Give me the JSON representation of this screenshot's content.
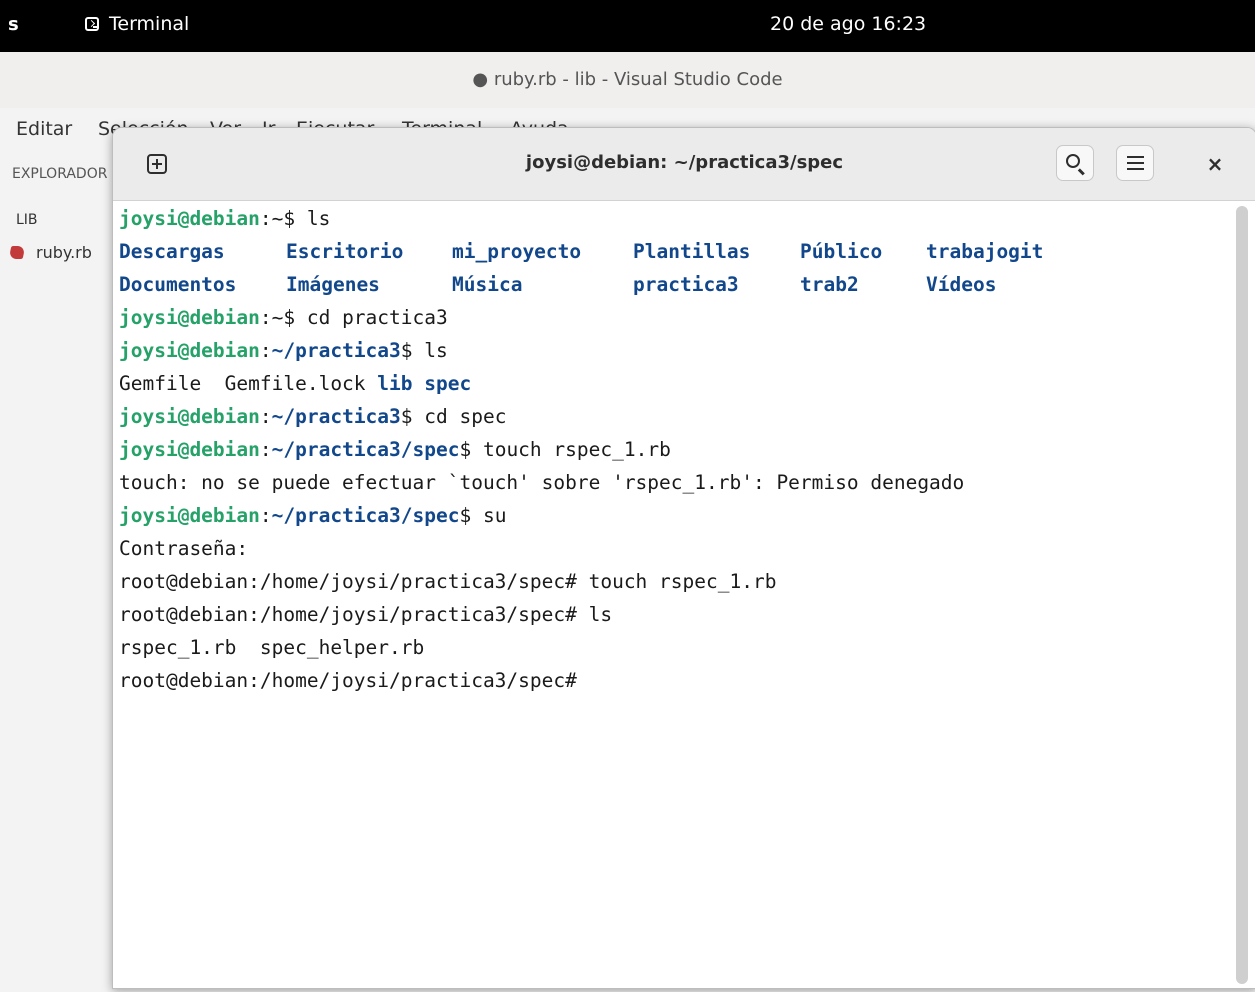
{
  "topbar": {
    "activities": "s",
    "app_name": "Terminal",
    "clock": "20 de ago  16:23"
  },
  "vscode": {
    "title": "● ruby.rb - lib - Visual Studio Code",
    "menu": [
      "Editar",
      "Selección",
      "Ver",
      "Ir",
      "Ejecutar",
      "Terminal",
      "Ayuda"
    ],
    "sidebar": {
      "explorer_label": "EXPLORADOR",
      "folder": "LIB",
      "file": "ruby.rb"
    }
  },
  "terminal": {
    "title": "joysi@debian: ~/practica3/spec",
    "lines": {
      "l1_user": "joysi@debian",
      "l1_rest": ":~$ ls",
      "ls_row1": [
        "Descargas",
        "Escritorio",
        "mi_proyecto",
        "Plantillas",
        "Público",
        "trabajogit"
      ],
      "ls_row2": [
        "Documentos",
        "Imágenes",
        "Música",
        "practica3",
        "trab2",
        "Vídeos"
      ],
      "l4_user": "joysi@debian",
      "l4_rest": ":~$ cd practica3",
      "l5_user": "joysi@debian",
      "l5_sep": ":",
      "l5_dir": "~/practica3",
      "l5_rest": "$ ls",
      "l6_files": "Gemfile  Gemfile.lock ",
      "l6_dir1": "lib",
      "l6_dir2": "spec",
      "l7_user": "joysi@debian",
      "l7_sep": ":",
      "l7_dir": "~/practica3",
      "l7_rest": "$ cd spec",
      "l8_user": "joysi@debian",
      "l8_sep": ":",
      "l8_dir": "~/practica3/spec",
      "l8_rest": "$ touch rspec_1.rb",
      "l9": "touch: no se puede efectuar `touch' sobre 'rspec_1.rb': Permiso denegado",
      "l10_user": "joysi@debian",
      "l10_sep": ":",
      "l10_dir": "~/practica3/spec",
      "l10_rest": "$ su",
      "l11": "Contraseña:",
      "l12": "root@debian:/home/joysi/practica3/spec# touch rspec_1.rb",
      "l13": "root@debian:/home/joysi/practica3/spec# ls",
      "l14": "rspec_1.rb  spec_helper.rb",
      "l15": "root@debian:/home/joysi/practica3/spec#"
    }
  }
}
